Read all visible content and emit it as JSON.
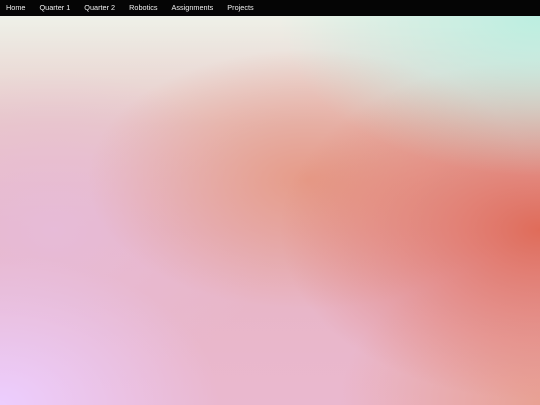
{
  "nav": {
    "items": [
      {
        "label": "Home"
      },
      {
        "label": "Quarter 1"
      },
      {
        "label": "Quarter 2"
      },
      {
        "label": "Robotics"
      },
      {
        "label": "Assignments"
      },
      {
        "label": "Projects"
      }
    ]
  },
  "colors": {
    "navbar_background": "#050505",
    "nav_text": "#f2f2f2",
    "gradient_mint": "#b9eee0",
    "gradient_coral": "#df6854",
    "gradient_lavender": "#eccdff",
    "gradient_pink": "#e7b5c3"
  }
}
